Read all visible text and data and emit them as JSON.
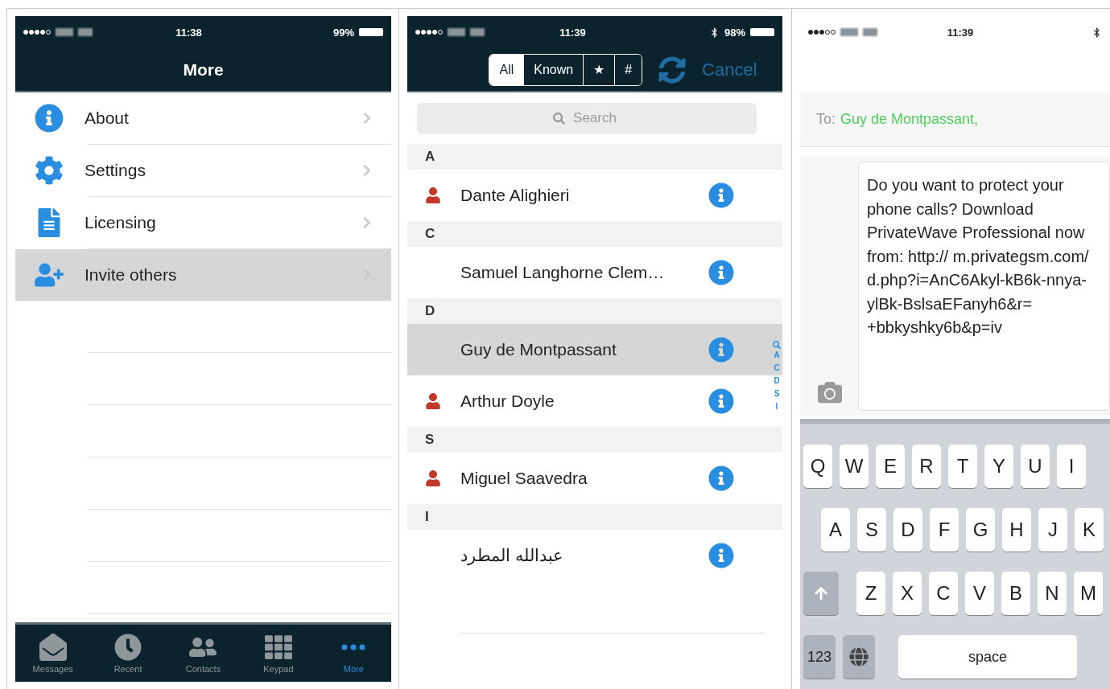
{
  "screens": [
    {
      "kind": "menu",
      "status": {
        "time": "11:38",
        "battery": "99%",
        "bluetooth": false
      },
      "title": "More",
      "items": [
        {
          "label": "About",
          "selected": false
        },
        {
          "label": "Settings",
          "selected": false
        },
        {
          "label": "Licensing",
          "selected": false
        },
        {
          "label": "Invite others",
          "selected": true
        }
      ],
      "tabs": [
        {
          "label": "Messages",
          "selected": false
        },
        {
          "label": "Recent",
          "selected": false
        },
        {
          "label": "Contacts",
          "selected": false
        },
        {
          "label": "Keypad",
          "selected": false
        },
        {
          "label": "More",
          "selected": true
        }
      ]
    },
    {
      "kind": "contacts",
      "status": {
        "time": "11:39",
        "battery": "98%",
        "bluetooth": true
      },
      "filters": [
        {
          "label": "All",
          "selected": true
        },
        {
          "label": "Known",
          "selected": false
        },
        {
          "label": "★",
          "selected": false
        },
        {
          "label": "#",
          "selected": false
        }
      ],
      "cancel": "Cancel",
      "search": {
        "placeholder": "Search"
      },
      "sections": [
        {
          "letter": "A",
          "contacts": [
            {
              "name": "Dante Alighieri",
              "has_app": true,
              "selected": false
            }
          ]
        },
        {
          "letter": "C",
          "contacts": [
            {
              "name": "Samuel Langhorne Clem…",
              "has_app": false,
              "selected": false
            }
          ]
        },
        {
          "letter": "D",
          "contacts": [
            {
              "name": "Guy de Montpassant",
              "has_app": false,
              "selected": true
            },
            {
              "name": "Arthur Doyle",
              "has_app": true,
              "selected": false
            }
          ]
        },
        {
          "letter": "S",
          "contacts": [
            {
              "name": "Miguel Saavedra",
              "has_app": true,
              "selected": false
            }
          ]
        },
        {
          "letter": "I",
          "contacts": [
            {
              "name": "عبدالله المطرد",
              "has_app": false,
              "selected": false
            }
          ]
        }
      ],
      "index": [
        "A",
        "C",
        "D",
        "S",
        "I"
      ]
    },
    {
      "kind": "compose",
      "status": {
        "time": "11:39",
        "bluetooth": true
      },
      "to_label": "To:",
      "recipient": "Guy de Montpassant,",
      "message": "Do you want to protect your phone calls? Download PrivateWave Professional now from: http:// m.privategsm.com/ d.php?i=AnC6Akyl-kB6k-nnya-ylBk-BslsaEFanyh6&r= +bbkyshky6b&p=iv",
      "keyboard": {
        "rows": [
          [
            "Q",
            "W",
            "E",
            "R",
            "T",
            "Y",
            "U",
            "I"
          ],
          [
            "A",
            "S",
            "D",
            "F",
            "G",
            "H",
            "J",
            "K"
          ],
          [
            "Z",
            "X",
            "C",
            "V",
            "B",
            "N",
            "M"
          ]
        ],
        "numbers_key": "123",
        "space_key": "space"
      }
    }
  ]
}
